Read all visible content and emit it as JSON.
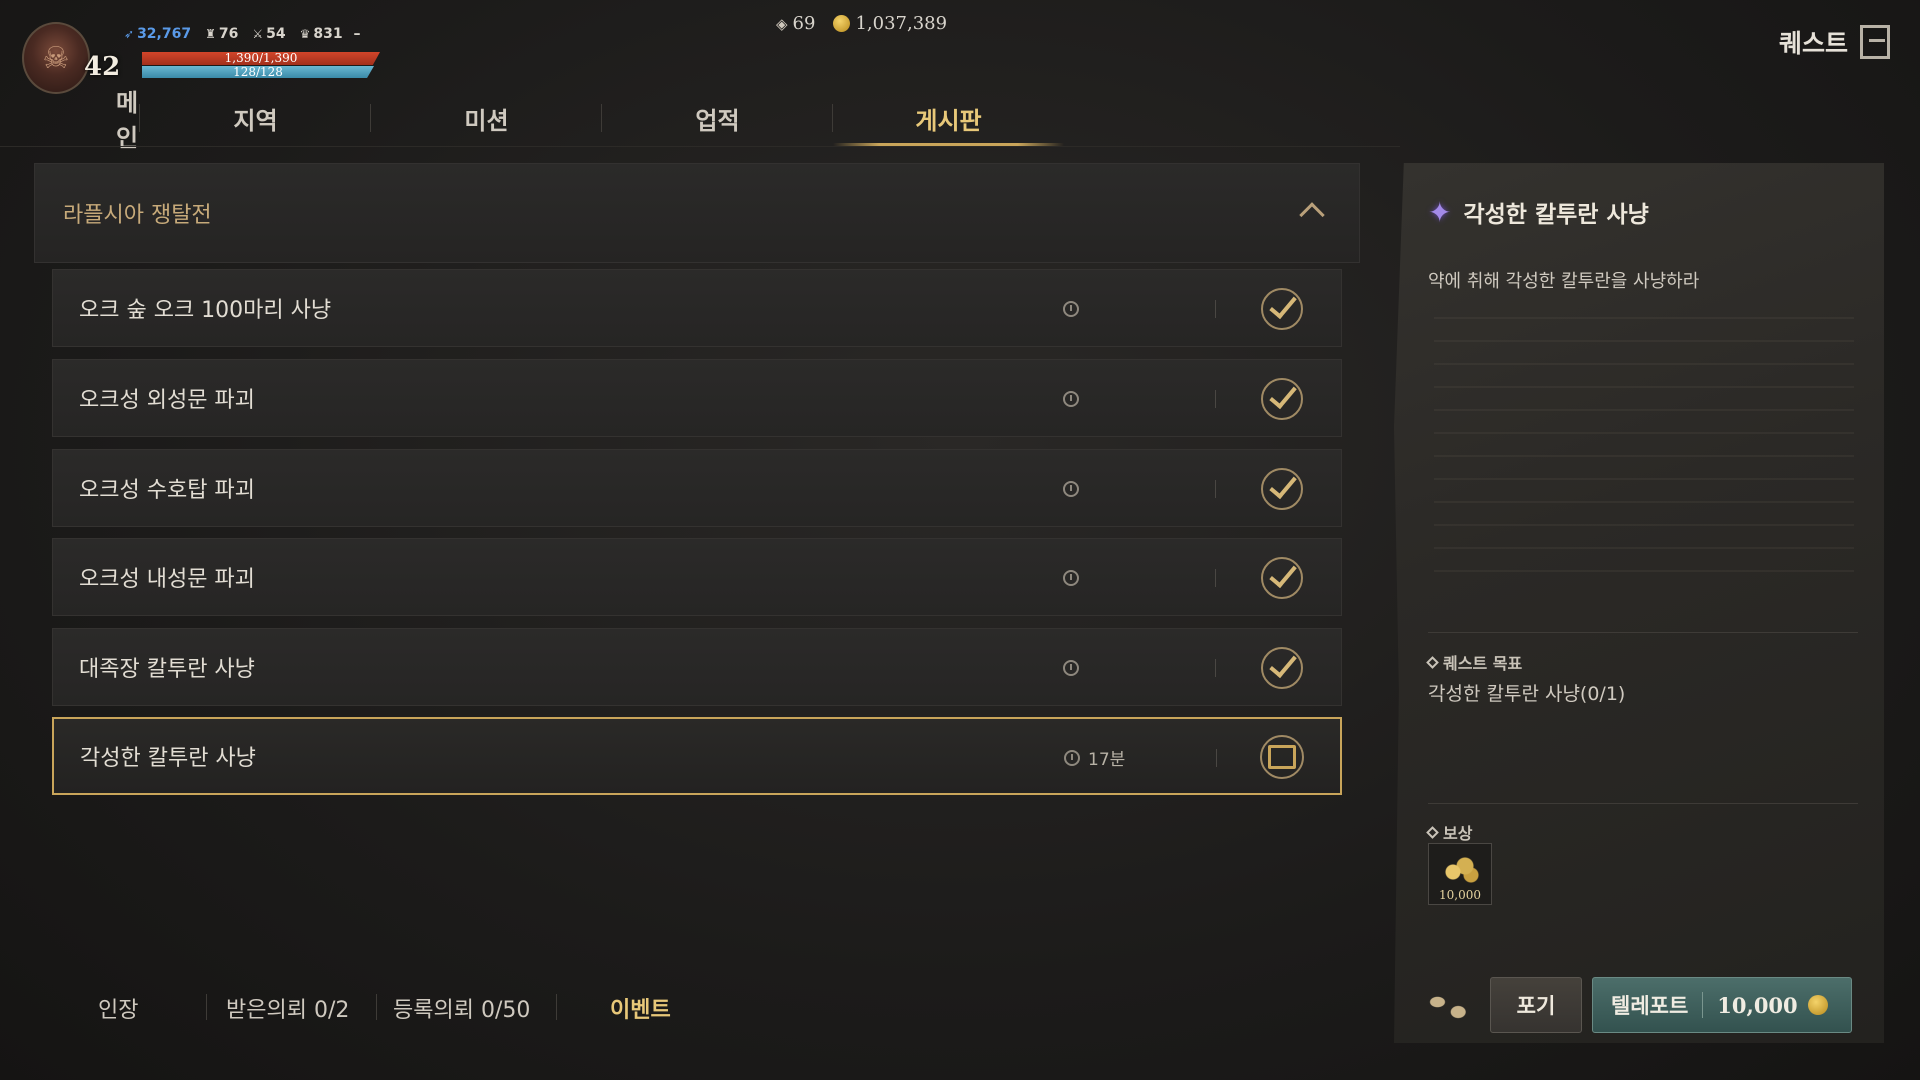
{
  "hud": {
    "level": "42",
    "stat1": "32,767",
    "stat2": "76",
    "stat3": "54",
    "stat4": "831",
    "stat4_suffix": "–",
    "hp": "1,390/1,390",
    "mp": "128/128"
  },
  "currency": {
    "gems": "69",
    "gold": "1,037,389"
  },
  "header": {
    "title": "퀘스트"
  },
  "tabs": [
    {
      "label": "메인"
    },
    {
      "label": "지역"
    },
    {
      "label": "미션"
    },
    {
      "label": "업적"
    },
    {
      "label": "게시판"
    }
  ],
  "active_tab": "게시판",
  "quest_group": {
    "title": "라플시아 쟁탈전"
  },
  "quests": [
    {
      "name": "오크 숲 오크 100마리 사냥",
      "time": "",
      "status": "complete"
    },
    {
      "name": "오크성 외성문 파괴",
      "time": "",
      "status": "complete"
    },
    {
      "name": "오크성 수호탑 파괴",
      "time": "",
      "status": "complete"
    },
    {
      "name": "오크성 내성문 파괴",
      "time": "",
      "status": "complete"
    },
    {
      "name": "대족장 칼투란 사냥",
      "time": "",
      "status": "complete"
    },
    {
      "name": "각성한 칼투란 사냥",
      "time": "17분",
      "status": "in-progress"
    }
  ],
  "bottom": {
    "seal": "인장",
    "received": "받은의뢰 0/2",
    "registered": "등록의뢰 0/50",
    "event": "이벤트"
  },
  "detail": {
    "title": "각성한 칼투란 사냥",
    "description": "약에 취해 각성한 칼투란을 사냥하라",
    "objective_label": "퀘스트 목표",
    "objective": "각성한 칼투란 사냥(0/1)",
    "reward_label": "보상",
    "reward_amount": "10,000"
  },
  "actions": {
    "give_up": "포기",
    "teleport": "텔레포트",
    "teleport_cost": "10,000"
  },
  "colors": {
    "accent_gold": "#c9a55a",
    "active_tab": "#e8c879",
    "hp": "#d2452a",
    "mp": "#6ab8d2",
    "teleport_button": "#4c6e6a"
  }
}
